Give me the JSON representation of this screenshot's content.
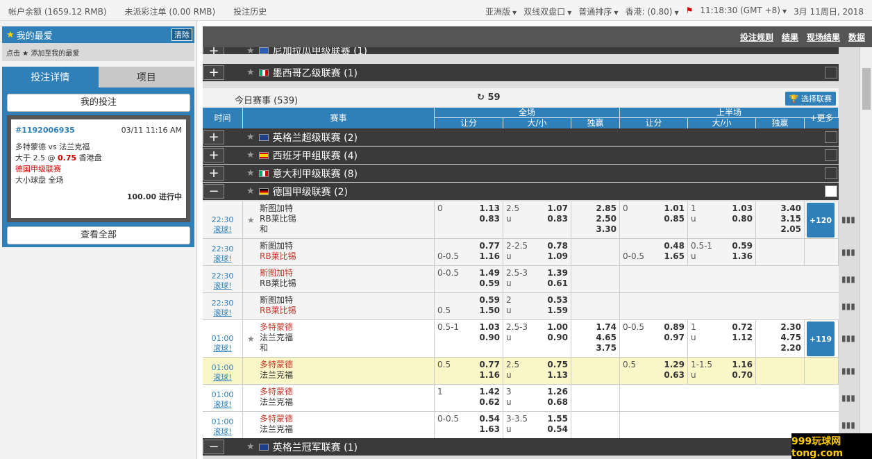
{
  "topbar": {
    "balance": "帐户余额 (1659.12 RMB)",
    "unsettled": "未派彩注单 (0.00 RMB)",
    "history": "投注历史",
    "asia": "亚洲版",
    "double": "双线双盘口",
    "sort": "普通排序",
    "odds": "香港: (0.80)",
    "clock": "11:18:30 (GMT +8)",
    "date": "3月 11周日, 2018"
  },
  "left": {
    "fav_title": "我的最爱",
    "clear": "清除",
    "fav_tip": "点击 ★ 添加至我的最爱",
    "tab_detail": "投注详情",
    "tab_items": "项目",
    "my_bets": "我的投注",
    "bet_id": "#1192006935",
    "bet_time": "03/11 11:16 AM",
    "bet_match": "多特蒙德 vs 法兰克福",
    "bet_line1": "大于 2.5 @ ",
    "bet_odds": "0.75",
    "bet_line1b": " 香港盘",
    "bet_league": "德国甲级联赛",
    "bet_type": "大小球盘 全场",
    "bet_amount": "100.00 进行中",
    "see_all": "查看全部"
  },
  "main": {
    "links": [
      "投注规则",
      "结果",
      "现场结果",
      "数据"
    ],
    "today": "今日赛事 (539)",
    "refresh": "59",
    "select_league": "选择联赛",
    "more": "+更多"
  },
  "headers": {
    "time": "时间",
    "event": "赛事",
    "full": "全场",
    "half": "上半场",
    "hdp": "让分",
    "ou": "大/小",
    "x12": "独赢",
    "hhdp": "让分",
    "hou": "大/小",
    "hx12": "独赢"
  },
  "leagues": [
    {
      "name": "尼加拉瓜甲级联赛 (1)",
      "pm": "+"
    },
    {
      "name": "墨西哥乙级联赛 (1)",
      "pm": "+"
    },
    {
      "name": "英格兰超级联赛 (2)",
      "pm": "+"
    },
    {
      "name": "西班牙甲组联赛 (4)",
      "pm": "+"
    },
    {
      "name": "意大利甲级联赛 (8)",
      "pm": "+"
    },
    {
      "name": "德国甲级联赛 (2)",
      "pm": "−"
    },
    {
      "name": "英格兰冠军联赛 (1)",
      "pm": "−"
    }
  ],
  "matches": [
    {
      "time": "22:30",
      "live": "滚球!",
      "home": "斯图加特",
      "away": "RB莱比锡",
      "draw": "和",
      "hdp": "0",
      "h1": "1.13",
      "h2": "0.83",
      "ou": "2.5",
      "ou2": "u",
      "o1": "1.07",
      "o2": "0.83",
      "x1": "2.85",
      "x2": "2.50",
      "x3": "3.30",
      "hhdp": "0",
      "hh1": "1.01",
      "hh2": "0.85",
      "hou": "1",
      "hou2": "u",
      "ho1": "1.03",
      "ho2": "0.80",
      "hx1": "3.40",
      "hx2": "3.15",
      "hx3": "2.05",
      "more": "+120"
    },
    {
      "time": "22:30",
      "live": "滚球!",
      "home": "斯图加特",
      "away": "RB莱比锡",
      "hdp2": "0-0.5",
      "h1": "0.77",
      "h2": "1.16",
      "ou": "2-2.5",
      "ou2": "u",
      "o1": "0.78",
      "o2": "1.09",
      "hhdp2": "0-0.5",
      "hh1": "0.48",
      "hh2": "1.65",
      "hou": "0.5-1",
      "hou2": "u",
      "ho1": "0.59",
      "ho2": "1.36"
    },
    {
      "time": "22:30",
      "live": "滚球!",
      "home": "斯图加特",
      "away": "RB莱比锡",
      "hdp": "0-0.5",
      "h1": "1.49",
      "h2": "0.59",
      "ou": "2.5-3",
      "ou2": "u",
      "o1": "1.39",
      "o2": "0.61"
    },
    {
      "time": "22:30",
      "live": "滚球!",
      "home": "斯图加特",
      "away": "RB莱比锡",
      "hdp2": "0.5",
      "h1": "0.59",
      "h2": "1.50",
      "ou": "2",
      "ou2": "u",
      "o1": "0.53",
      "o2": "1.59"
    },
    {
      "time": "01:00",
      "live": "滚球!",
      "home": "多特蒙德",
      "away": "法兰克福",
      "draw": "和",
      "hdp": "0.5-1",
      "h1": "1.03",
      "h2": "0.90",
      "ou": "2.5-3",
      "ou2": "u",
      "o1": "1.00",
      "o2": "0.90",
      "x1": "1.74",
      "x2": "4.65",
      "x3": "3.75",
      "hhdp": "0-0.5",
      "hh1": "0.89",
      "hh2": "0.97",
      "hou": "1",
      "hou2": "u",
      "ho1": "0.72",
      "ho2": "1.12",
      "hx1": "2.30",
      "hx2": "4.75",
      "hx3": "2.20",
      "more": "+119"
    },
    {
      "time": "01:00",
      "live": "滚球!",
      "home": "多特蒙德",
      "away": "法兰克福",
      "hdp": "0.5",
      "h1": "0.77",
      "h2": "1.16",
      "ou": "2.5",
      "ou2": "u",
      "o1": "0.75",
      "o2": "1.13",
      "hhdp": "0.5",
      "hh1": "1.29",
      "hh2": "0.63",
      "hou": "1-1.5",
      "hou2": "u",
      "ho1": "1.16",
      "ho2": "0.70"
    },
    {
      "time": "01:00",
      "live": "滚球!",
      "home": "多特蒙德",
      "away": "法兰克福",
      "hdp": "1",
      "h1": "1.42",
      "h2": "0.62",
      "ou": "3",
      "ou2": "u",
      "o1": "1.26",
      "o2": "0.68"
    },
    {
      "time": "01:00",
      "live": "滚球!",
      "home": "多特蒙德",
      "away": "法兰克福",
      "hdp": "0-0.5",
      "h1": "0.54",
      "h2": "1.63",
      "ou": "3-3.5",
      "ou2": "u",
      "o1": "1.55",
      "o2": "0.54"
    }
  ],
  "watermark": "999玩球网 tong.com"
}
